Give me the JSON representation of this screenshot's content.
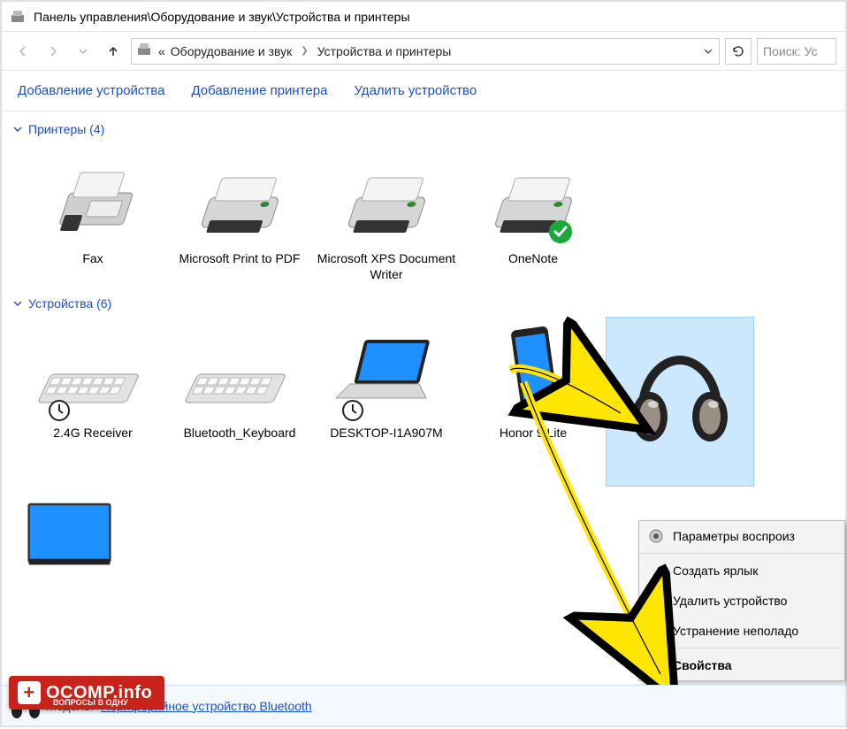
{
  "title": "Панель управления\\Оборудование и звук\\Устройства и принтеры",
  "breadcrumbs": {
    "prefix": "«",
    "a": "Оборудование и звук",
    "b": "Устройства и принтеры"
  },
  "search_placeholder": "Поиск: Ус",
  "toolbar": {
    "add_device": "Добавление устройства",
    "add_printer": "Добавление принтера",
    "remove_device": "Удалить устройство"
  },
  "groups": {
    "printers": {
      "title": "Принтеры (4)"
    },
    "devices": {
      "title": "Устройства (6)"
    }
  },
  "printers": [
    {
      "label": "Fax"
    },
    {
      "label": "Microsoft Print to PDF"
    },
    {
      "label": "Microsoft XPS Document Writer"
    },
    {
      "label": "OneNote",
      "default": true
    }
  ],
  "devices": [
    {
      "label": "2.4G Receiver",
      "pending": true
    },
    {
      "label": "Bluetooth_Keyboard"
    },
    {
      "label": "DESKTOP-I1A907M",
      "pending": true
    },
    {
      "label": "Honor 9 Lite"
    },
    {
      "label": "",
      "selected": true
    },
    {
      "label": ""
    }
  ],
  "context_menu": {
    "playback": "Параметры воспроиз",
    "shortcut": "Создать ярлык",
    "remove": "Удалить устройство",
    "troubleshoot": "Устранение неполадо",
    "properties": "Свойства"
  },
  "status": {
    "model_label": "Модель:",
    "model_value": "Периферийное устройство Bluetooth"
  },
  "watermark": {
    "text": "OCOMP.info",
    "sub": "ВОПРОСЫ В ОДНУ"
  }
}
